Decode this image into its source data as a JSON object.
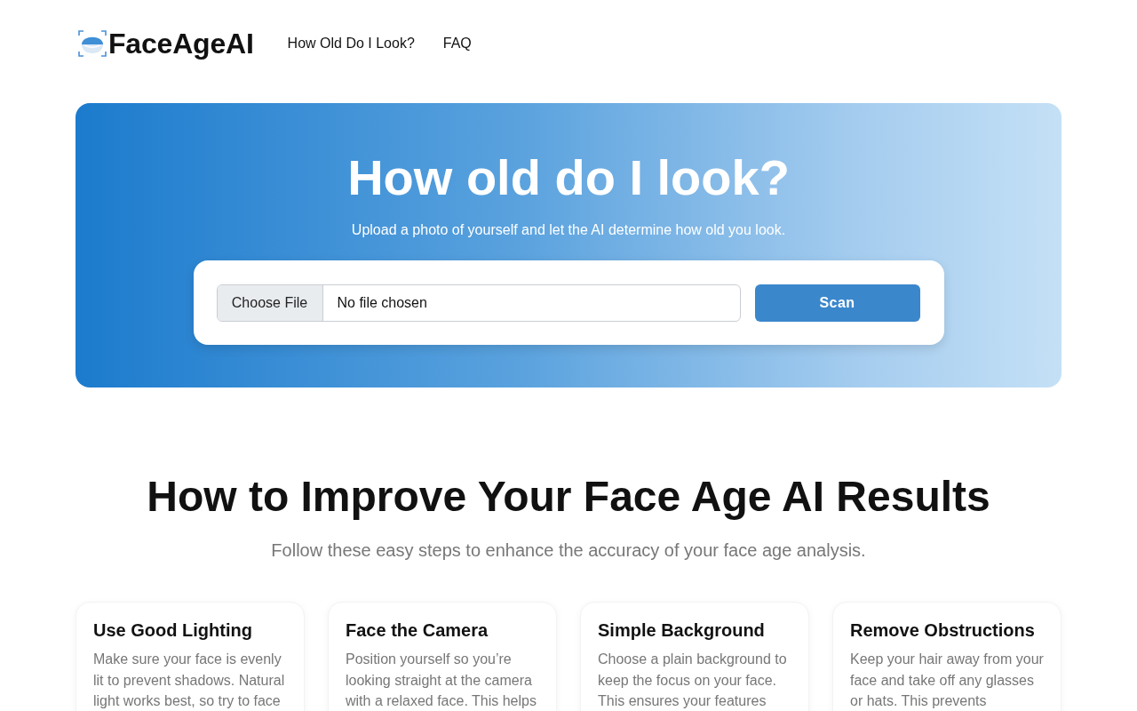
{
  "header": {
    "logo": {
      "text": "FaceAgeAI"
    },
    "nav": [
      {
        "label": "How Old Do I Look?"
      },
      {
        "label": "FAQ"
      }
    ]
  },
  "hero": {
    "title": "How old do I look?",
    "subtitle": "Upload a photo of yourself and let the AI determine how old you look.",
    "upload": {
      "button": "Choose File",
      "status": "No file chosen"
    },
    "submit": "Scan"
  },
  "tips": {
    "title": "How to Improve Your Face Age AI Results",
    "subtitle": "Follow these easy steps to enhance the accuracy of your face age analysis.",
    "cards": [
      {
        "title": "Use Good Lighting",
        "text": "Make sure your face is evenly lit to prevent shadows. Natural light works best, so try to face"
      },
      {
        "title": "Face the Camera",
        "text": "Position yourself so you’re looking straight at the camera with a relaxed face. This helps"
      },
      {
        "title": "Simple Background",
        "text": "Choose a plain background to keep the focus on your face. This ensures your features"
      },
      {
        "title": "Remove Obstructions",
        "text": "Keep your hair away from your face and take off any glasses or hats. This prevents"
      }
    ]
  }
}
